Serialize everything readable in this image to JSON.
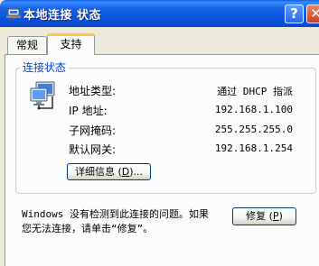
{
  "window": {
    "title": "本地连接 状态",
    "help_label": "?",
    "close_label": "✕"
  },
  "tabs": [
    {
      "label": "常规",
      "active": false
    },
    {
      "label": "支持",
      "active": true
    }
  ],
  "group": {
    "legend": "连接状态",
    "rows": [
      {
        "label": "地址类型:",
        "value": "通过 DHCP 指派"
      },
      {
        "label": "IP 地址:",
        "value": "192.168.1.100"
      },
      {
        "label": "子网掩码:",
        "value": "255.255.255.0"
      },
      {
        "label": "默认网关:",
        "value": "192.168.1.254"
      }
    ],
    "details_button": {
      "text": "详细信息 (",
      "mnemonic": "D",
      "suffix": ")..."
    }
  },
  "message": {
    "line1": "Windows 没有检测到此连接的问题。如果",
    "line2": "您无法连接，请单击“修复”。"
  },
  "repair_button": {
    "text": "修复 (",
    "mnemonic": "P",
    "suffix": ")"
  },
  "colors": {
    "titlebar": "#0a53de",
    "legend": "#0046d5",
    "tab_highlight": "#ffc83c",
    "dialog_bg": "#ece9d8"
  }
}
